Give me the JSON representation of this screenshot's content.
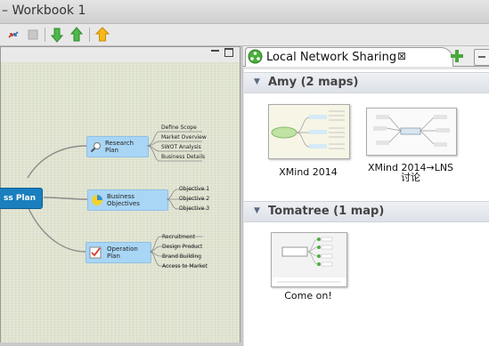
{
  "window": {
    "title": "– Workbook 1"
  },
  "toolbar": {
    "icons": [
      "sync-icon",
      "stop-icon",
      "drill-down-icon",
      "drill-up-icon",
      "home-icon"
    ]
  },
  "mindmap": {
    "central_topic": "ss Plan",
    "branches": [
      {
        "label": "Research Plan",
        "icon": "magnifier-icon",
        "subtopics": [
          "Define Scope",
          "Market Overview",
          "SWOT Analysis",
          "Business Details"
        ]
      },
      {
        "label": "Business Objectives",
        "icon": "pie-chart-icon",
        "subtopics": [
          "Objective 1",
          "Objective 2",
          "Objective 3"
        ]
      },
      {
        "label": "Operation Plan",
        "icon": "checkbox-icon",
        "subtopics": [
          "Recruitment",
          "Design Product",
          "Brand Building",
          "Access to Market"
        ]
      }
    ]
  },
  "sharing": {
    "tab_title": "Local Network Sharing",
    "groups": [
      {
        "header": "Amy (2 maps)",
        "maps": [
          {
            "title": "XMind 2014"
          },
          {
            "title_line1": "XMind 2014→LNS",
            "title_line2": "讨论"
          }
        ]
      },
      {
        "header": "Tomatree (1 map)",
        "maps": [
          {
            "title": "Come on!"
          }
        ]
      }
    ]
  },
  "colors": {
    "topic_fill": "#a9d6f5",
    "central_fill": "#1a7fbf",
    "accent_green": "#3cab3c"
  }
}
